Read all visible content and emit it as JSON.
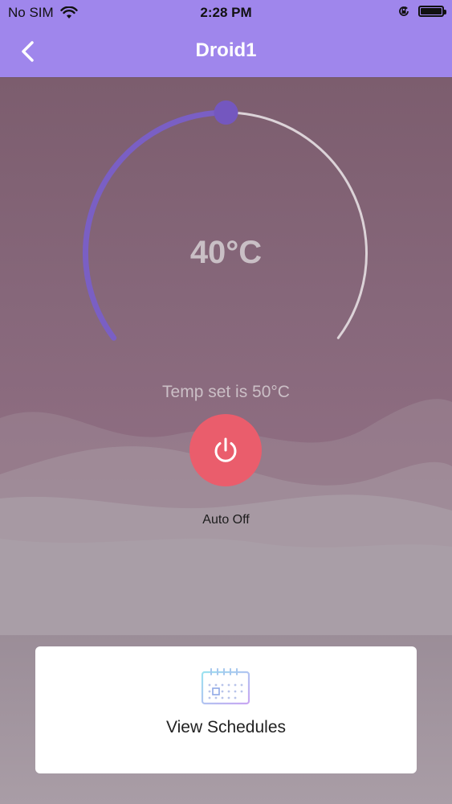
{
  "status_bar": {
    "carrier": "No SIM",
    "time": "2:28 PM",
    "icons": [
      "wifi-icon",
      "orientation-lock-icon",
      "battery-icon"
    ]
  },
  "header": {
    "title": "Droid1",
    "back_icon": "chevron-left-icon"
  },
  "thermostat": {
    "current_temp": "40°C",
    "set_label": "Temp set is 50°C",
    "dial_level": 0.5
  },
  "power": {
    "icon": "power-icon",
    "mode_label": "Auto Off"
  },
  "schedules_card": {
    "icon": "calendar-icon",
    "label": "View Schedules"
  },
  "colors": {
    "header": "#9f86ec",
    "dial_active": "#7a5fc4",
    "dial_track": "#dcd3d8",
    "power_button": "#ea5d6c"
  }
}
